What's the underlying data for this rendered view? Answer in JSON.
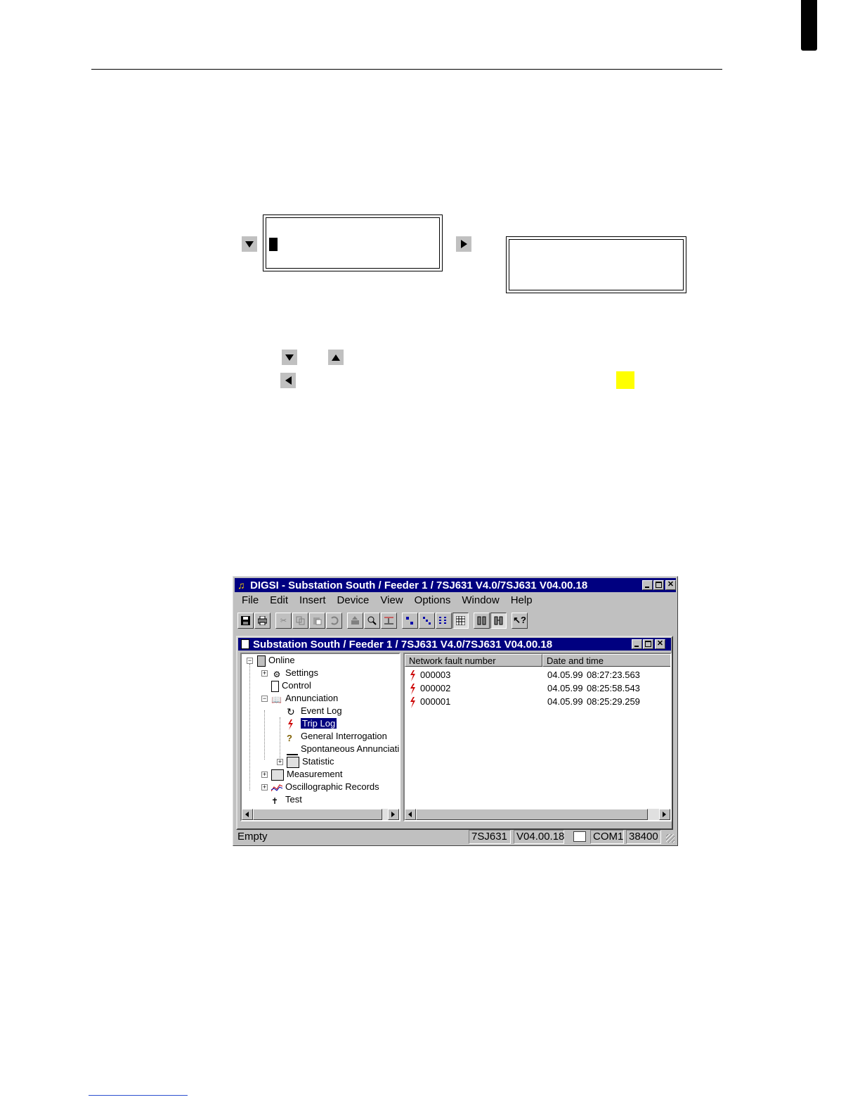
{
  "window": {
    "title": "DIGSI - Substation South / Feeder 1 / 7SJ631 V4.0/7SJ631 V04.00.18",
    "menu": [
      "File",
      "Edit",
      "Insert",
      "Device",
      "View",
      "Options",
      "Window",
      "Help"
    ],
    "child_title": "Substation South / Feeder 1 / 7SJ631 V4.0/7SJ631 V04.00.18"
  },
  "tree": {
    "root": "Online",
    "items": [
      "Settings",
      "Control",
      "Annunciation",
      "Event Log",
      "Trip Log",
      "General Interrogation",
      "Spontaneous Annunciatio",
      "Statistic",
      "Measurement",
      "Oscillographic Records",
      "Test"
    ],
    "selected": "Trip Log"
  },
  "list": {
    "columns": [
      "Network fault number",
      "Date and time"
    ],
    "rows": [
      {
        "number": "000003",
        "date": "04.05.99",
        "time": "08:27:23.563"
      },
      {
        "number": "000002",
        "date": "04.05.99",
        "time": "08:25:58.543"
      },
      {
        "number": "000001",
        "date": "04.05.99",
        "time": "08:25:29.259"
      }
    ]
  },
  "status": {
    "text": "Empty",
    "device": "7SJ631",
    "version": "V04.00.18",
    "port": "COM1",
    "baud": "38400"
  },
  "colors": {
    "title_bar": "#000080",
    "highlight": "#ffff00",
    "fault_icon": "#cc0000"
  }
}
